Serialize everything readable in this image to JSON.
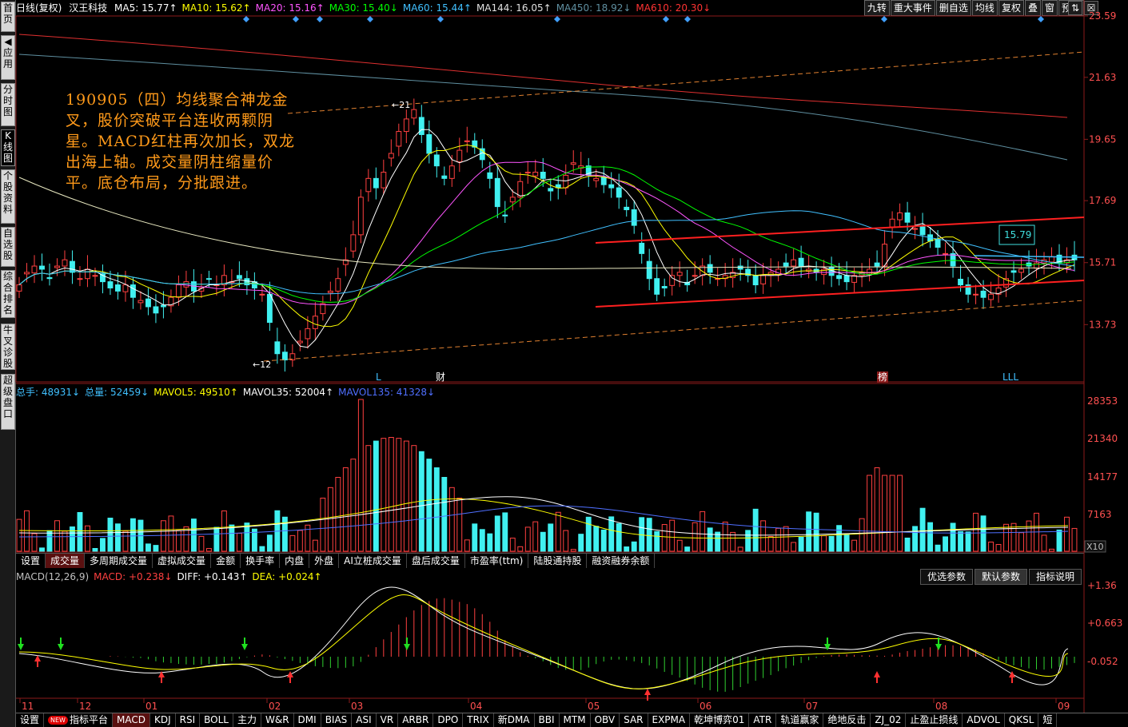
{
  "left_sidebar": [
    {
      "label": "首页"
    },
    {
      "label": "应用",
      "prefix": "◀"
    },
    {
      "label": "分时图"
    },
    {
      "label": "K线图",
      "active": true
    },
    {
      "label": "个股资料"
    },
    {
      "label": "自选股"
    },
    {
      "label": "综合排名"
    },
    {
      "label": "牛叉诊股"
    },
    {
      "label": "超级盘口"
    }
  ],
  "header": {
    "period": "日线(复权)",
    "stock_name": "汉王科技",
    "ma_items": [
      {
        "text": "MA5: 15.77↑",
        "color": "#ffffff"
      },
      {
        "text": "MA10: 15.62↑",
        "color": "#ffff00"
      },
      {
        "text": "MA20: 15.16↑",
        "color": "#ff55ff"
      },
      {
        "text": "MA30: 15.40↓",
        "color": "#00ff00"
      },
      {
        "text": "MA60: 15.44↑",
        "color": "#40c0ff"
      },
      {
        "text": "MA144: 16.05↑",
        "color": "#e0e0e0"
      },
      {
        "text": "MA450: 18.92↓",
        "color": "#5f8fa0"
      },
      {
        "text": "MA610: 20.30↓",
        "color": "#ff3333"
      }
    ],
    "buttons": [
      "九转",
      "重大事件",
      "删自选",
      "均线",
      "复权",
      "叠",
      "窗",
      "预测"
    ],
    "window_controls": [
      "⇅",
      "☒"
    ]
  },
  "price_axis": {
    "labels": [
      "23.59",
      "21.63",
      "19.65",
      "17.69",
      "15.71",
      "13.73"
    ],
    "max": 23.59,
    "min": 11.9
  },
  "annotation": "190905（四）均线聚合神龙金叉，股价突破平台连收两颗阴星。MACD红柱再次加长，双龙出海上轴。成交量阴柱缩量价平。底仓布局，分批跟进。",
  "price_markers": {
    "high": "21",
    "low": "12",
    "current": "15.79"
  },
  "event_markers": [
    "L",
    "财",
    "榜",
    "LLL"
  ],
  "volume": {
    "items": [
      {
        "text": "总手: 48931↓",
        "color": "#40c0ff"
      },
      {
        "text": "总量: 52459↓",
        "color": "#40c0ff"
      },
      {
        "text": "MAVOL5: 49510↑",
        "color": "#ffff00"
      },
      {
        "text": "MAVOL35: 52004↑",
        "color": "#ffffff"
      },
      {
        "text": "MAVOL135: 41328↓",
        "color": "#4f6fff"
      }
    ],
    "axis": [
      "28353",
      "21340",
      "14177",
      "7163"
    ],
    "unit": "X10"
  },
  "volume_tabs": [
    "设置",
    "成交量",
    "多周期成交量",
    "虚拟成交量",
    "金额",
    "换手率",
    "内盘",
    "外盘",
    "AI立桩成交量",
    "盘后成交量",
    "市盈率(ttm)",
    "陆股通持股",
    "融资融券余额"
  ],
  "macd": {
    "items": [
      {
        "text": "MACD(12,26,9)",
        "color": "#c0c0c0"
      },
      {
        "text": "MACD: +0.238↓",
        "color": "#ff4040"
      },
      {
        "text": "DIFF: +0.143↑",
        "color": "#ffffff"
      },
      {
        "text": "DEA: +0.024↑",
        "color": "#ffff00"
      }
    ],
    "buttons": [
      "优选参数",
      "默认参数",
      "指标说明"
    ],
    "axis": [
      "+1.36",
      "+0.663",
      "-0.052"
    ]
  },
  "months": [
    "11",
    "12",
    "01",
    "02",
    "03",
    "04",
    "05",
    "06",
    "07",
    "08",
    "09"
  ],
  "bottom_tabs": [
    "设置",
    "指标平台",
    "MACD",
    "KDJ",
    "RSI",
    "BOLL",
    "主力",
    "W&R",
    "DMI",
    "BIAS",
    "ASI",
    "VR",
    "ARBR",
    "DPO",
    "TRIX",
    "新DMA",
    "BBI",
    "MTM",
    "OBV",
    "SAR",
    "EXPMA",
    "乾坤博弈01",
    "ATR",
    "轨道赢家",
    "绝地反击",
    "ZJ_02",
    "止盈止损线",
    "ADVOL",
    "QKSL",
    "短"
  ],
  "bottom_new_badge": "NEW",
  "chart_data": {
    "type": "candlestick",
    "closes": [
      15.0,
      15.4,
      15.6,
      15.5,
      15.2,
      15.6,
      15.8,
      15.4,
      15.2,
      15.5,
      15.3,
      15.1,
      14.9,
      14.8,
      15.0,
      14.6,
      14.5,
      14.3,
      14.1,
      14.3,
      14.6,
      15.0,
      15.1,
      14.8,
      14.9,
      15.2,
      15.0,
      15.3,
      15.1,
      15.2,
      15.0,
      14.9,
      14.7,
      13.8,
      12.8,
      12.6,
      12.8,
      13.2,
      13.6,
      14.0,
      14.4,
      14.8,
      15.2,
      15.8,
      16.6,
      17.8,
      18.4,
      18.1,
      18.6,
      19.2,
      19.9,
      20.3,
      20.6,
      19.8,
      19.2,
      18.8,
      18.4,
      18.8,
      19.3,
      19.6,
      19.4,
      19.0,
      18.4,
      17.5,
      17.2,
      17.8,
      18.3,
      18.6,
      18.6,
      18.4,
      18.0,
      18.1,
      18.5,
      18.9,
      18.8,
      18.5,
      18.4,
      18.2,
      18.1,
      17.8,
      17.4,
      16.9,
      16.0,
      15.2,
      14.7,
      14.9,
      15.3,
      15.4,
      15.0,
      15.3,
      15.6,
      15.4,
      15.2,
      15.3,
      15.4,
      15.5,
      15.3,
      15.0,
      15.3,
      15.4,
      15.5,
      15.6,
      15.8,
      15.6,
      15.5,
      15.4,
      15.5,
      15.3,
      15.2,
      15.1,
      15.3,
      15.4,
      15.5,
      15.6,
      16.3,
      17.1,
      17.3,
      17.0,
      16.8,
      16.6,
      16.4,
      16.2,
      16.0,
      15.6,
      15.0,
      14.7,
      14.7,
      14.6,
      14.7,
      14.9,
      15.2,
      15.4,
      15.5,
      15.6,
      15.7,
      15.8,
      15.9,
      15.7,
      15.8,
      15.8
    ]
  }
}
